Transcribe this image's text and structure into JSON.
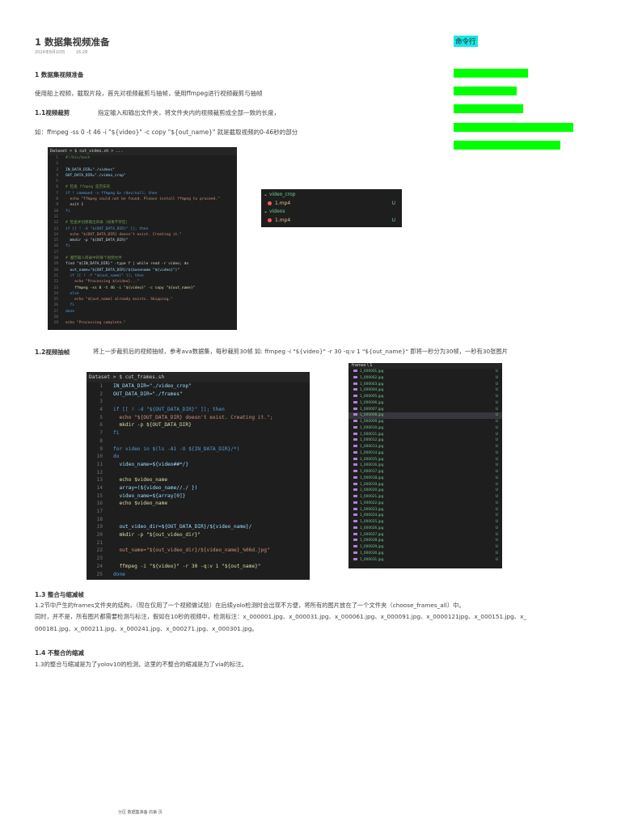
{
  "doc": {
    "title": "1 数据集视频准备",
    "date": "2024年8月10日",
    "time": "16:28",
    "section_heading": "1  数据集视频准备",
    "intro": "使用船上视频，截取片段，首先对视频裁剪与抽帧，使用ffmpeg进行视频裁剪与抽帧",
    "s11_title": "1.1视频裁剪",
    "s11_desc": "指定输入和输出文件夹，将文件夹内的视频裁剪成全部一致的长度，",
    "s11_example": "如：ffmpeg -ss 0 -t 46 -i \"${video}\" -c copy \"${out_name}\"  就是截取视频的0-46秒的部分",
    "s12_title": "1.2视频抽帧",
    "s12_desc": "将上一步裁剪后的视频抽帧，参考ava数据集，每秒裁剪30帧  如:   ffmpeg -i \"${video}\" -r 30 -q:v 1 \"${out_name}\"   即将一秒分为30帧，一秒有30张图片",
    "s13_title": "1.3 整合与缩减帧",
    "s13_line1": "1.2节中产生的frames文件夹的结构，（现在仅用了一个视频做试验）在后续yolo检测时会出现不方便，将所有的图片放在了一个文件夹（choose_frames_all）中。",
    "s13_line2": "同时，并不是，所有图片都需要检测与标注，假如在10秒的视频中，检测标注：x_000001.jpg、x_000031.jpg、x_000061.jpg、x_000091.jpg、x_0000121jpg、x_000151.jpg、x_",
    "s13_line3": "000181.jpg、x_000211.jpg、x_000241.jpg、x_000271.jpg、x_000301.jpg。",
    "s14_title": "1.4 不整合的缩减",
    "s14_line1": "1.3的整合与缩减是为了yolov10的检测，这里的不整合的缩减是为了via的标注。",
    "footer": "分区 数据集准备 的第    页"
  },
  "sidebar": {
    "label": "命令行",
    "highlight_color": "#19e6e6",
    "bar_color": "#00ff00"
  },
  "code1": {
    "tab": "Dataset > $  cut_video.sh > ...",
    "lines": [
      {
        "n": "1",
        "t": "#!/bin/bash",
        "c": "cm"
      },
      {
        "n": "2",
        "t": "",
        "c": ""
      },
      {
        "n": "3",
        "t": "IN_DATA_DIR=\"./videos\"",
        "c": "vr"
      },
      {
        "n": "4",
        "t": "OUT_DATA_DIR=\"./video_crop\"",
        "c": "vr"
      },
      {
        "n": "5",
        "t": "",
        "c": ""
      },
      {
        "n": "6",
        "t": "# 检查 ffmpeg 是否安装",
        "c": "cm"
      },
      {
        "n": "7",
        "t": "if ! command -v ffmpeg &> /dev/null; then",
        "c": "kw"
      },
      {
        "n": "8",
        "t": "  echo \"ffmpeg could not be found. Please install ffmpeg to proceed.\"",
        "c": "st"
      },
      {
        "n": "9",
        "t": "  exit 1",
        "c": ""
      },
      {
        "n": "10",
        "t": "fi",
        "c": "kw"
      },
      {
        "n": "11",
        "t": "",
        "c": ""
      },
      {
        "n": "12",
        "t": "# 检查并创建输出目录（如果不存在）",
        "c": "cm"
      },
      {
        "n": "13",
        "t": "if [[ ! -d \"${OUT_DATA_DIR}\" ]]; then",
        "c": "kw"
      },
      {
        "n": "14",
        "t": "  echo \"${OUT_DATA_DIR} doesn't exist. Creating it.\"",
        "c": "st"
      },
      {
        "n": "15",
        "t": "  mkdir -p \"${OUT_DATA_DIR}\"",
        "c": ""
      },
      {
        "n": "16",
        "t": "fi",
        "c": "kw"
      },
      {
        "n": "17",
        "t": "",
        "c": ""
      },
      {
        "n": "18",
        "t": "# 遍历输入目录中的每个视频文件",
        "c": "cm"
      },
      {
        "n": "19",
        "t": "find \"${IN_DATA_DIR}\" -type f | while read -r video; do",
        "c": ""
      },
      {
        "n": "20",
        "t": "  out_name=\"${OUT_DATA_DIR}/$(basename \"${video}\")\"",
        "c": "vr"
      },
      {
        "n": "21",
        "t": "  if [[ ! -f \"${out_name}\" ]]; then",
        "c": "kw"
      },
      {
        "n": "22",
        "t": "    echo \"Processing ${video}...\"",
        "c": "st"
      },
      {
        "n": "23",
        "t": "    ffmpeg -ss 0 -t 46 -i \"${video}\" -c copy \"${out_name}\"",
        "c": "fn"
      },
      {
        "n": "24",
        "t": "  else",
        "c": "kw"
      },
      {
        "n": "25",
        "t": "    echo \"${out_name} already exists. Skipping.\"",
        "c": "st"
      },
      {
        "n": "26",
        "t": "  fi",
        "c": "kw"
      },
      {
        "n": "27",
        "t": "done",
        "c": "kw"
      },
      {
        "n": "28",
        "t": "",
        "c": ""
      },
      {
        "n": "29",
        "t": "echo \"Processing complete.\"",
        "c": "st"
      }
    ]
  },
  "explorer1": {
    "rows": [
      {
        "label": "video_crop",
        "type": "folder",
        "badge": ""
      },
      {
        "label": "1.mp4",
        "type": "file",
        "badge": "U"
      },
      {
        "label": "videos",
        "type": "folder",
        "badge": ""
      },
      {
        "label": "1.mp4",
        "type": "file",
        "badge": "U"
      }
    ]
  },
  "code2": {
    "tab": "Dataset > $  cut_frames.sh",
    "lines": [
      {
        "n": "1",
        "t": "IN_DATA_DIR=\"./video_crop\"",
        "c": "vr"
      },
      {
        "n": "2",
        "t": "OUT_DATA_DIR=\"./frames\"",
        "c": "vr"
      },
      {
        "n": "3",
        "t": "",
        "c": ""
      },
      {
        "n": "4",
        "t": "if [[ ! -d \"${OUT_DATA_DIR}\" ]]; then",
        "c": "kw"
      },
      {
        "n": "5",
        "t": "  echo \"${OUT_DATA_DIR} doesn't exist. Creating it.\";",
        "c": "st"
      },
      {
        "n": "6",
        "t": "  mkdir -p ${OUT_DATA_DIR}",
        "c": "fn"
      },
      {
        "n": "7",
        "t": "fi",
        "c": "kw"
      },
      {
        "n": "8",
        "t": "",
        "c": ""
      },
      {
        "n": "9",
        "t": "for video in $(ls -A1 -U ${IN_DATA_DIR}/*)",
        "c": "kw"
      },
      {
        "n": "10",
        "t": "do",
        "c": "kw"
      },
      {
        "n": "11",
        "t": "  video_name=${video##*/}",
        "c": "vr"
      },
      {
        "n": "12",
        "t": "",
        "c": ""
      },
      {
        "n": "13",
        "t": "  echo $video_name",
        "c": "fn"
      },
      {
        "n": "14",
        "t": "  array=(${video_name//./ })",
        "c": "vr"
      },
      {
        "n": "15",
        "t": "  video_name=${array[0]}",
        "c": "vr"
      },
      {
        "n": "16",
        "t": "  echo $video_name",
        "c": "fn"
      },
      {
        "n": "17",
        "t": "",
        "c": ""
      },
      {
        "n": "18",
        "t": "",
        "c": ""
      },
      {
        "n": "19",
        "t": "  out_video_dir=${OUT_DATA_DIR}/${video_name}/",
        "c": "vr"
      },
      {
        "n": "20",
        "t": "  mkdir -p \"${out_video_dir}\"",
        "c": "fn"
      },
      {
        "n": "21",
        "t": "",
        "c": ""
      },
      {
        "n": "22",
        "t": "  out_name=\"${out_video_dir}/${video_name}_%06d.jpg\"",
        "c": "st"
      },
      {
        "n": "23",
        "t": "",
        "c": ""
      },
      {
        "n": "24",
        "t": "  ffmpeg -i \"${video}\" -r 30 -q:v 1 \"${out_name}\"",
        "c": "fn"
      },
      {
        "n": "25",
        "t": "done",
        "c": "kw"
      }
    ]
  },
  "explorer2": {
    "header": "frames \\ 1",
    "badge": "U",
    "files": [
      "1_000001.jpg",
      "1_000002.jpg",
      "1_000003.jpg",
      "1_000004.jpg",
      "1_000005.jpg",
      "1_000006.jpg",
      "1_000007.jpg",
      "1_000008.jpg",
      "1_000009.jpg",
      "1_000010.jpg",
      "1_000011.jpg",
      "1_000012.jpg",
      "1_000013.jpg",
      "1_000014.jpg",
      "1_000015.jpg",
      "1_000016.jpg",
      "1_000017.jpg",
      "1_000018.jpg",
      "1_000019.jpg",
      "1_000020.jpg",
      "1_000021.jpg",
      "1_000022.jpg",
      "1_000023.jpg",
      "1_000024.jpg",
      "1_000025.jpg",
      "1_000026.jpg",
      "1_000027.jpg",
      "1_000028.jpg",
      "1_000029.jpg",
      "1_000030.jpg",
      "1_000031.jpg"
    ],
    "selected_index": 7
  }
}
